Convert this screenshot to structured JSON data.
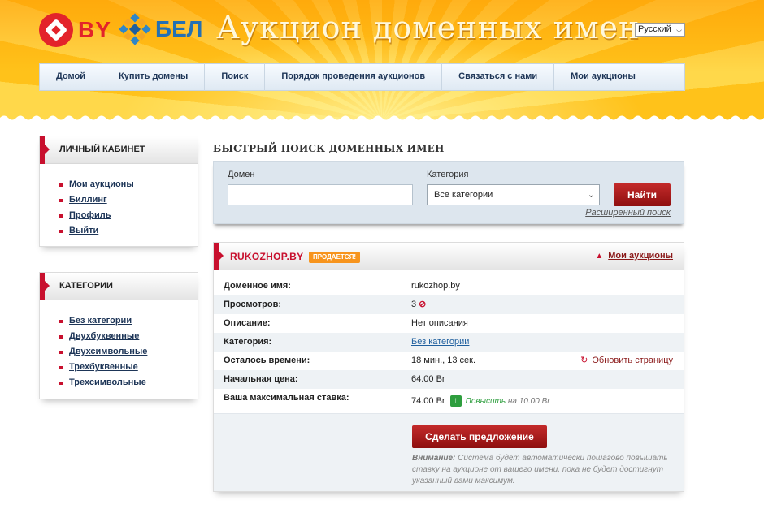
{
  "header": {
    "logo_by": "BY",
    "logo_bel": "БЕЛ",
    "site_title": "Аукцион доменных имен",
    "language": "Русский"
  },
  "nav": [
    "Домой",
    "Купить домены",
    "Поиск",
    "Порядок проведения аукционов",
    "Связаться с нами",
    "Мои аукционы"
  ],
  "account": {
    "title": "ЛИЧНЫЙ КАБИНЕТ",
    "items": [
      "Мои аукционы",
      "Биллинг",
      "Профиль",
      "Выйти"
    ]
  },
  "categories": {
    "title": "КАТЕГОРИИ",
    "items": [
      "Без категории",
      "Двухбуквенные",
      "Двухсимвольные",
      "Трехбуквенные",
      "Трехсимвольные"
    ]
  },
  "quick_search": {
    "title": "БЫСТРЫЙ ПОИСК ДОМЕННЫХ ИМЕН",
    "domain_label": "Домен",
    "domain_value": "",
    "category_label": "Категория",
    "category_value": "Все категории",
    "search_button": "Найти",
    "advanced_link": "Расширенный поиск"
  },
  "auction": {
    "domain": "RUKOZHOP.BY",
    "badge": "ПРОДАЕТСЯ!",
    "my_auctions_link": "Мои аукционы",
    "rows": {
      "domain_name": {
        "label": "Доменное имя:",
        "value": "rukozhop.by"
      },
      "views": {
        "label": "Просмотров:",
        "value": "3"
      },
      "description": {
        "label": "Описание:",
        "value": "Нет описания"
      },
      "category": {
        "label": "Категория:",
        "value": "Без категории"
      },
      "time_left": {
        "label": "Осталось времени:",
        "value": "18 мин., 13 сек."
      },
      "start_price": {
        "label": "Начальная цена:",
        "value": "64.00 Br"
      },
      "max_bid": {
        "label": "Ваша максимальная ставка:",
        "value": "74.00 Br"
      }
    },
    "refresh_link": "Обновить страницу",
    "raise_text": "Повысить",
    "raise_amount": "на 10.00 Br",
    "offer_button": "Сделать предложение",
    "note_label": "Внимание:",
    "note_text": "Система будет автоматически пошагово повышать ставку на аукционе от вашего имени, пока не будет достигнут указанный вами максимум."
  },
  "colors": {
    "accent_red": "#c8102e",
    "header_orange": "#ffc21a",
    "nav_text": "#1d3557",
    "positive_green": "#2e9e3e"
  }
}
